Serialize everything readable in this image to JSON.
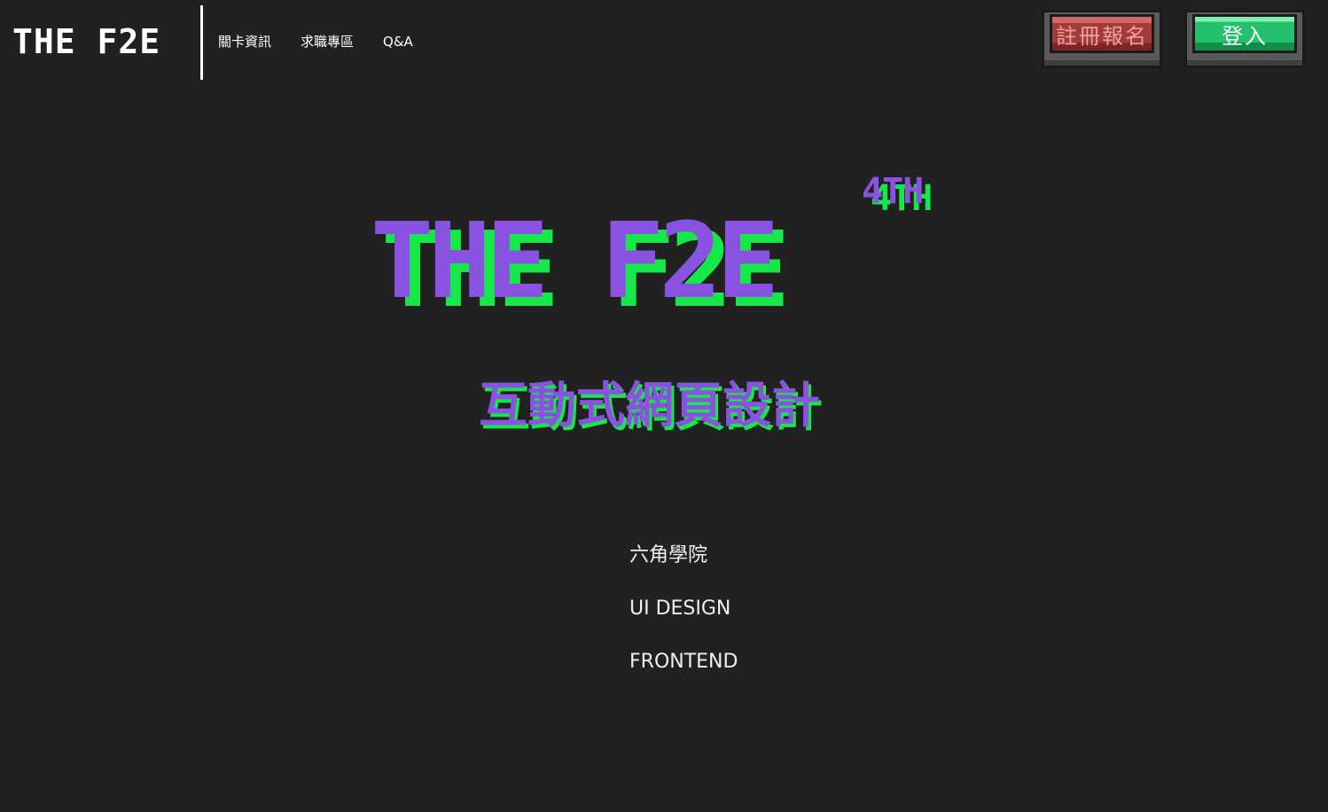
{
  "header": {
    "logo": "THE F2E",
    "nav": [
      {
        "label": "關卡資訊"
      },
      {
        "label": "求職專區"
      },
      {
        "label": "Q&A"
      }
    ],
    "register_label": "註冊報名",
    "login_label": "登入"
  },
  "hero": {
    "title": "THE F2E",
    "badge": "4TH",
    "subtitle": "互動式網頁設計"
  },
  "info": {
    "items": [
      {
        "label": "六角學院"
      },
      {
        "label": "UI DESIGN"
      },
      {
        "label": "FRONTEND"
      }
    ]
  },
  "colors": {
    "background": "#212121",
    "accent_purple": "#8a52e0",
    "accent_green": "#17e84a",
    "register_red": "#a63a38",
    "login_green": "#25c06d"
  }
}
